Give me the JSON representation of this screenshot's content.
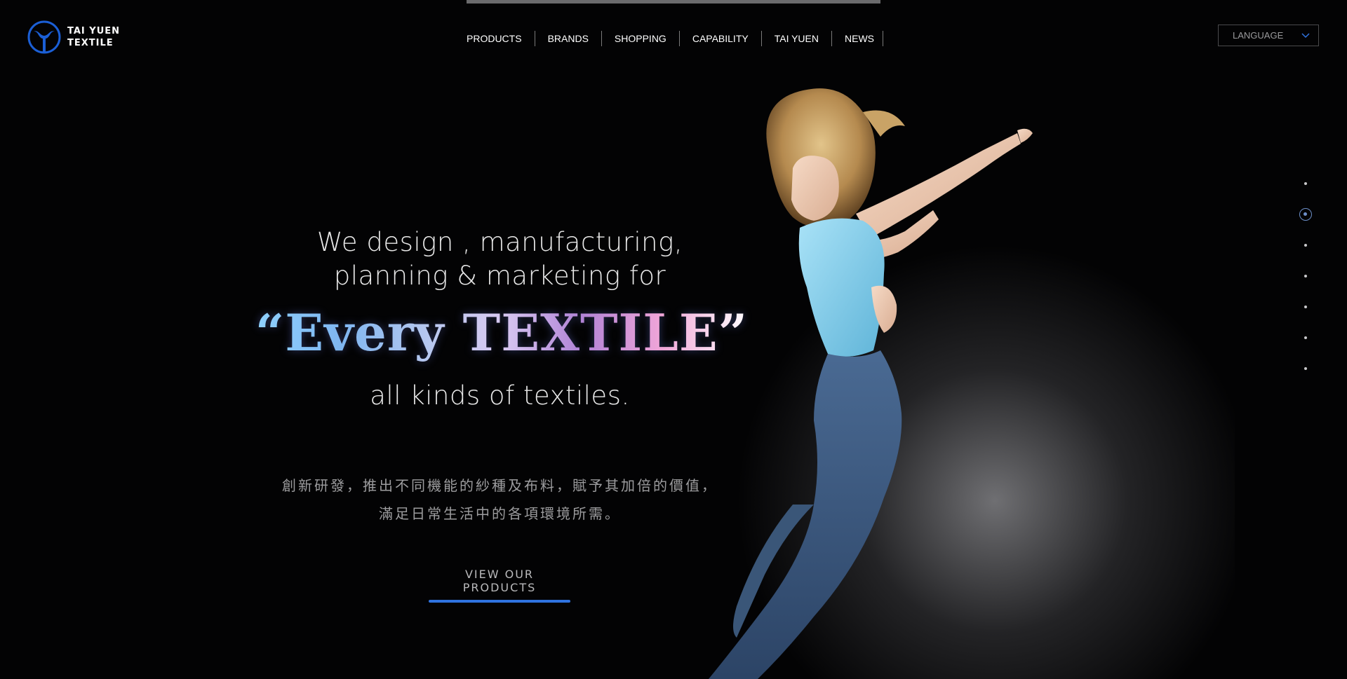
{
  "header": {
    "logo_line1": "TAI YUEN",
    "logo_line2": "TEXTILE",
    "nav": [
      "PRODUCTS",
      "BRANDS",
      "SHOPPING",
      "CAPABILITY",
      "TAI YUEN",
      "NEWS"
    ],
    "language_label": "LANGUAGE"
  },
  "hero": {
    "line1": "We design , manufacturing,",
    "line2": "planning & marketing for",
    "highlight": "“Every TEXTILE”",
    "line3": "all kinds of textiles.",
    "chinese_line1": "創新研發，推出不同機能的紗種及布料，賦予其加倍的價值，",
    "chinese_line2": "滿足日常生活中的各項環境所需。",
    "cta_label": "VIEW OUR PRODUCTS"
  },
  "pager": {
    "count": 7,
    "active_index": 1
  },
  "colors": {
    "background": "#030304",
    "accent_blue": "#2f73e0",
    "logo_blue": "#1b5fd6",
    "pager_active": "#6d8fc9"
  },
  "icons": {
    "logo": "tai-yuen-logo-icon",
    "language_chevron": "chevron-down-icon"
  }
}
